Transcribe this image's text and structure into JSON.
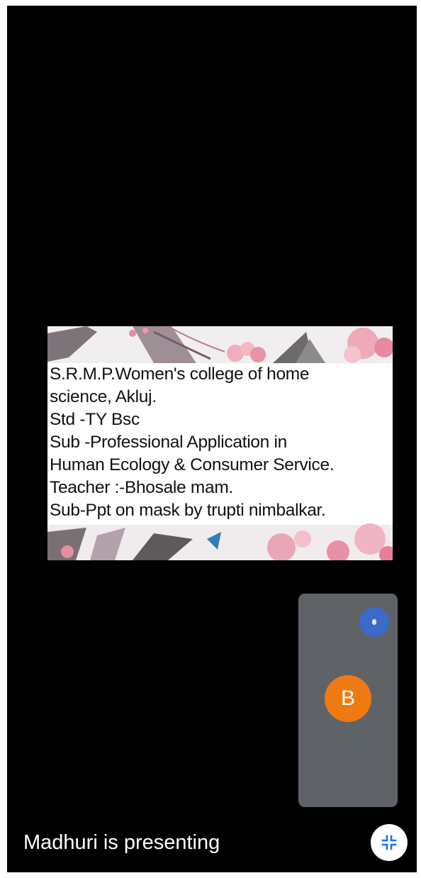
{
  "slide": {
    "lines": [
      "S.R.M.P.Women's college of home",
      "science, Akluj.",
      "Std -TY Bsc",
      "Sub -Professional Application in",
      "Human Ecology & Consumer Service.",
      "Teacher :-Bhosale mam.",
      "Sub-Ppt on mask by trupti nimbalkar."
    ]
  },
  "self_tile": {
    "avatar_initial": "B",
    "avatar_color": "#f07a12",
    "mic_indicator_color": "#3c6ac8"
  },
  "presenter": {
    "label": "Madhuri is presenting"
  },
  "controls": {
    "collapse_icon": "collapse-fullscreen-icon"
  },
  "colors": {
    "background": "#000000",
    "tile": "#5f6368"
  }
}
